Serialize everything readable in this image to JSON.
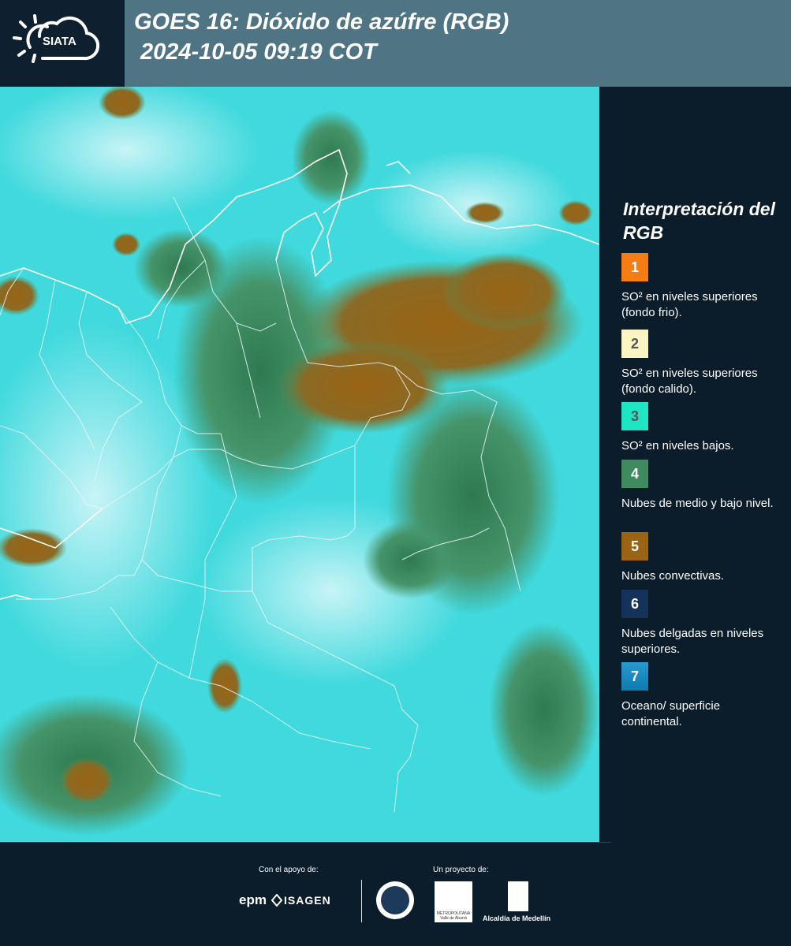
{
  "header": {
    "logo_text": "SIATA",
    "title_line1": "GOES 16: Dióxido de azúfre (RGB)",
    "title_line2": "2024-10-05 09:19 COT"
  },
  "legend": {
    "title": "Interpretación del RGB",
    "items": [
      {
        "number": "1",
        "color": "#f57d14",
        "text_color": "#ffffff",
        "label": "SO² en niveles superiores (fondo frio)."
      },
      {
        "number": "2",
        "color": "#fdf6c2",
        "text_color": "#555555",
        "label": "SO² en niveles superiores (fondo calido)."
      },
      {
        "number": "3",
        "color": "#1ee6c4",
        "text_color": "#555555",
        "label": "SO² en niveles bajos."
      },
      {
        "number": "4",
        "color": "#3f8a5e",
        "text_color": "#ffffff",
        "label": "Nubes de medio y bajo nivel."
      },
      {
        "number": "5",
        "color": "#9a6414",
        "text_color": "#ffffff",
        "label": "Nubes convectivas."
      },
      {
        "number": "6",
        "color": "#14325a",
        "text_color": "#ffffff",
        "label": "Nubes delgadas en niveles superiores."
      },
      {
        "number": "7",
        "color": "#1a8ec4",
        "text_color": "#ffffff",
        "label": "Oceano/ superficie continental."
      }
    ]
  },
  "footer": {
    "support_label": "Con el apoyo de:",
    "project_label": "Un proyecto de:",
    "epm_text": "epm",
    "isagen_text": "ISAGEN",
    "area_text": "METROPOLITANA Valle de Aburrá",
    "alcaldia_text": "Alcaldía de Medellín"
  },
  "colors": {
    "header_bar": "#4f7585",
    "background": "#0b1c2a",
    "map_base": "#3fd8dc",
    "cloud_green": "#3f8a5e",
    "cloud_brown": "#9a6414"
  }
}
